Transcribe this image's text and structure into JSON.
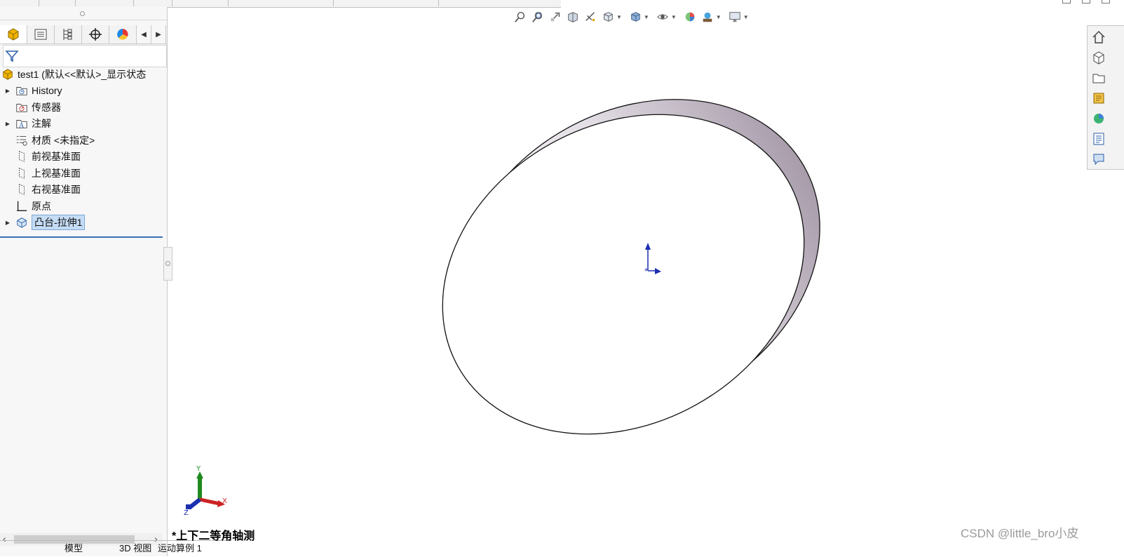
{
  "feature_tree": {
    "root_label": "test1  (默认<<默认>_显示状态",
    "items": [
      {
        "label": "History",
        "icon": "history-folder-icon",
        "expandable": true
      },
      {
        "label": "传感器",
        "icon": "sensor-folder-icon",
        "expandable": false
      },
      {
        "label": "注解",
        "icon": "annotation-folder-icon",
        "expandable": true
      },
      {
        "label": "材质 <未指定>",
        "icon": "material-icon",
        "expandable": false
      },
      {
        "label": "前视基准面",
        "icon": "plane-icon",
        "expandable": false
      },
      {
        "label": "上视基准面",
        "icon": "plane-icon",
        "expandable": false
      },
      {
        "label": "右视基准面",
        "icon": "plane-icon",
        "expandable": false
      },
      {
        "label": "原点",
        "icon": "origin-icon",
        "expandable": false
      },
      {
        "label": "凸台-拉伸1",
        "icon": "extrude-icon",
        "expandable": true,
        "selected": true
      }
    ]
  },
  "manager_tabs": [
    "featuremanager-icon",
    "propertymanager-icon",
    "configurationmanager-icon",
    "dimxpert-icon",
    "displaymanager-icon"
  ],
  "bottom_tabs": [
    "模型",
    "3D 视图",
    "运动算例 1"
  ],
  "viewport": {
    "view_orientation": "*上下二等角轴测",
    "triad": {
      "x": "X",
      "y": "Y",
      "z": "Z"
    }
  },
  "watermark": "CSDN @little_bro小皮",
  "colors": {
    "accent": "#3b6fb6",
    "selection": "#c5dcf5",
    "model_edge": "#111111",
    "model_side_shade": "#a89cab",
    "axis_x": "#cc2222",
    "axis_y": "#1f8a1f",
    "axis_z": "#1b2fb0"
  }
}
